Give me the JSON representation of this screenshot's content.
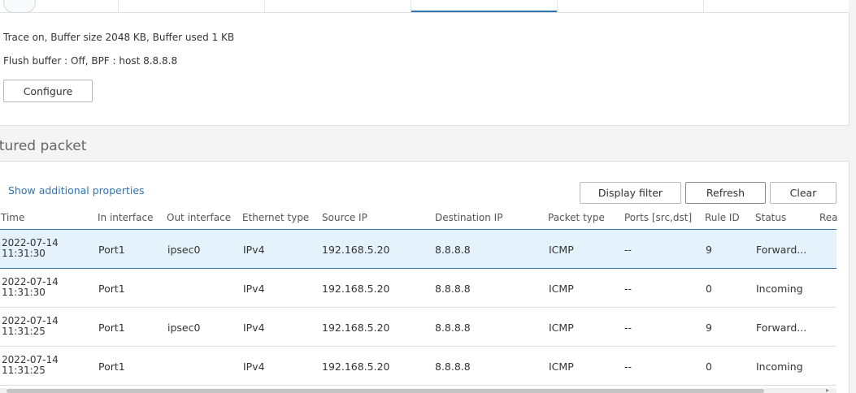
{
  "trace": {
    "line1": "Trace on, Buffer size 2048 KB, Buffer used 1 KB",
    "line2": "Flush buffer : Off, BPF : host 8.8.8.8",
    "configure_label": "Configure"
  },
  "captured": {
    "title": "ptured packet",
    "show_props_label": "Show additional properties",
    "display_filter_label": "Display filter",
    "refresh_label": "Refresh",
    "clear_label": "Clear"
  },
  "columns": {
    "time": "Time",
    "in_interface": "In interface",
    "out_interface": "Out interface",
    "ethernet_type": "Ethernet type",
    "source_ip": "Source IP",
    "destination_ip": "Destination IP",
    "packet_type": "Packet type",
    "ports": "Ports [src,dst]",
    "rule_id": "Rule ID",
    "status": "Status",
    "reason": "Rea"
  },
  "rows": [
    {
      "date": "2022-07-14",
      "time": "11:31:30",
      "in": "Port1",
      "out": "ipsec0",
      "eth": "IPv4",
      "src": "192.168.5.20",
      "dst": "8.8.8.8",
      "ptype": "ICMP",
      "ports": "--",
      "rule": "9",
      "status": "Forward..."
    },
    {
      "date": "2022-07-14",
      "time": "11:31:30",
      "in": "Port1",
      "out": "",
      "eth": "IPv4",
      "src": "192.168.5.20",
      "dst": "8.8.8.8",
      "ptype": "ICMP",
      "ports": "--",
      "rule": "0",
      "status": "Incoming"
    },
    {
      "date": "2022-07-14",
      "time": "11:31:25",
      "in": "Port1",
      "out": "ipsec0",
      "eth": "IPv4",
      "src": "192.168.5.20",
      "dst": "8.8.8.8",
      "ptype": "ICMP",
      "ports": "--",
      "rule": "9",
      "status": "Forward..."
    },
    {
      "date": "2022-07-14",
      "time": "11:31:25",
      "in": "Port1",
      "out": "",
      "eth": "IPv4",
      "src": "192.168.5.20",
      "dst": "8.8.8.8",
      "ptype": "ICMP",
      "ports": "--",
      "rule": "0",
      "status": "Incoming"
    }
  ],
  "colors": {
    "accent": "#2e76b6",
    "selected_row": "#e3f2fb"
  }
}
